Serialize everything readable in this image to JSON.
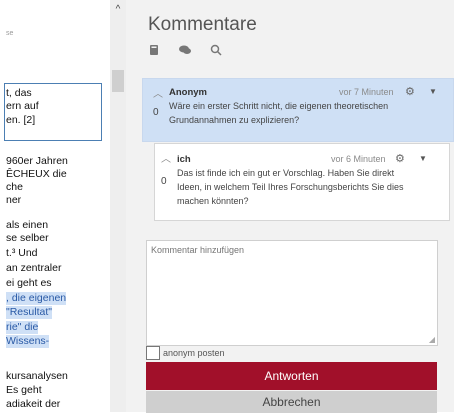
{
  "document": {
    "hint": "se",
    "lines": [
      "t, das",
      "ern auf",
      "en. [2]",
      "960er Jahren",
      "ÊCHEUX die",
      "che",
      "ner",
      "als einen",
      "se selber",
      "t.³ Und",
      "an zentraler",
      "ei geht es",
      ", die eigenen",
      "\"Resultat\"",
      "rie\" die",
      "Wissens-",
      "kursanalysen",
      "Es geht",
      "adiakeit der"
    ]
  },
  "panel": {
    "title": "Kommentare",
    "tools": {
      "book_icon": "book-icon",
      "chat_icon": "chat-icon",
      "search_icon": "search-icon"
    },
    "comments": [
      {
        "count": "0",
        "author": "Anonym",
        "time": "vor 7 Minuten",
        "text_line1": "Wäre ein erster Schritt nicht, die eigenen theoretischen",
        "text_line2": "Grundannahmen zu explizieren?"
      },
      {
        "count": "0",
        "author": "ich",
        "time": "vor 6 Minuten",
        "text_line1": "Das ist finde ich ein gut er Vorschlag. Haben Sie direkt",
        "text_line2": "Ideen, in welchem Teil Ihres Forschungsberichts Sie dies",
        "text_line3": "machen könnten?"
      }
    ],
    "composer": {
      "placeholder": "Kommentar hinzufügen"
    },
    "anonymous_label": "anonym posten",
    "reply_label": "Antworten",
    "cancel_label": "Abbrechen"
  },
  "colors": {
    "accent": "#a1102a",
    "highlight": "#cfe0f5"
  }
}
